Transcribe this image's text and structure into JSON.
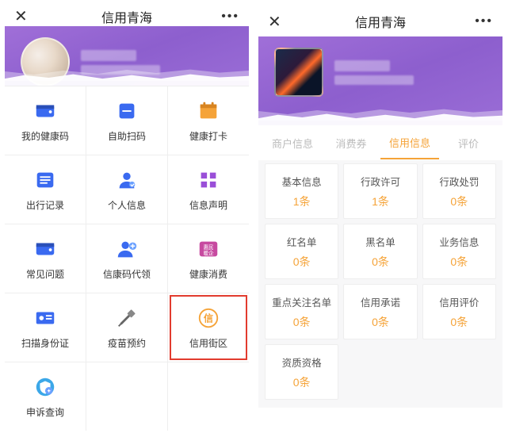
{
  "left": {
    "title": "信用青海",
    "grid": [
      {
        "name": "health-code",
        "label": "我的健康码"
      },
      {
        "name": "self-scan",
        "label": "自助扫码"
      },
      {
        "name": "health-checkin",
        "label": "健康打卡"
      },
      {
        "name": "travel-record",
        "label": "出行记录"
      },
      {
        "name": "personal-info",
        "label": "个人信息"
      },
      {
        "name": "info-statement",
        "label": "信息声明"
      },
      {
        "name": "faq",
        "label": "常见问题"
      },
      {
        "name": "code-proxy",
        "label": "信康码代领"
      },
      {
        "name": "health-consume",
        "label": "健康消费"
      },
      {
        "name": "scan-id",
        "label": "扫描身份证"
      },
      {
        "name": "vaccine-book",
        "label": "疫苗预约"
      },
      {
        "name": "credit-street",
        "label": "信用街区",
        "highlight": true
      },
      {
        "name": "appeal-query",
        "label": "申诉查询"
      }
    ]
  },
  "right": {
    "title": "信用青海",
    "tabs": [
      {
        "name": "merchant",
        "label": "商户信息",
        "active": false
      },
      {
        "name": "coupon",
        "label": "消费券",
        "active": false
      },
      {
        "name": "credit",
        "label": "信用信息",
        "active": true
      },
      {
        "name": "review",
        "label": "评价",
        "active": false
      }
    ],
    "cards": [
      {
        "name": "basic",
        "title": "基本信息",
        "value": "1条"
      },
      {
        "name": "permit",
        "title": "行政许可",
        "value": "1条"
      },
      {
        "name": "penalty",
        "title": "行政处罚",
        "value": "0条"
      },
      {
        "name": "redlist",
        "title": "红名单",
        "value": "0条"
      },
      {
        "name": "blacklist",
        "title": "黑名单",
        "value": "0条"
      },
      {
        "name": "biz",
        "title": "业务信息",
        "value": "0条"
      },
      {
        "name": "focus",
        "title": "重点关注名单",
        "value": "0条"
      },
      {
        "name": "promise",
        "title": "信用承诺",
        "value": "0条"
      },
      {
        "name": "eval",
        "title": "信用评价",
        "value": "0条"
      },
      {
        "name": "qualify",
        "title": "资质资格",
        "value": "0条"
      }
    ]
  },
  "icons": {
    "health-code": {
      "cls": "blue",
      "svg": "wallet"
    },
    "self-scan": {
      "cls": "blue",
      "svg": "scan"
    },
    "health-checkin": {
      "cls": "orange",
      "svg": "cal"
    },
    "travel-record": {
      "cls": "blue",
      "svg": "list"
    },
    "personal-info": {
      "cls": "blue",
      "svg": "person"
    },
    "info-statement": {
      "cls": "purple",
      "svg": "grid4"
    },
    "faq": {
      "cls": "blue",
      "svg": "wallet"
    },
    "code-proxy": {
      "cls": "blue",
      "svg": "personplus"
    },
    "health-consume": {
      "cls": "pink",
      "svg": "hui"
    },
    "scan-id": {
      "cls": "blue",
      "svg": "idcard"
    },
    "vaccine-book": {
      "cls": "",
      "svg": "syringe"
    },
    "credit-street": {
      "cls": "",
      "svg": "xin"
    },
    "appeal-query": {
      "cls": "blue",
      "svg": "shield"
    }
  }
}
